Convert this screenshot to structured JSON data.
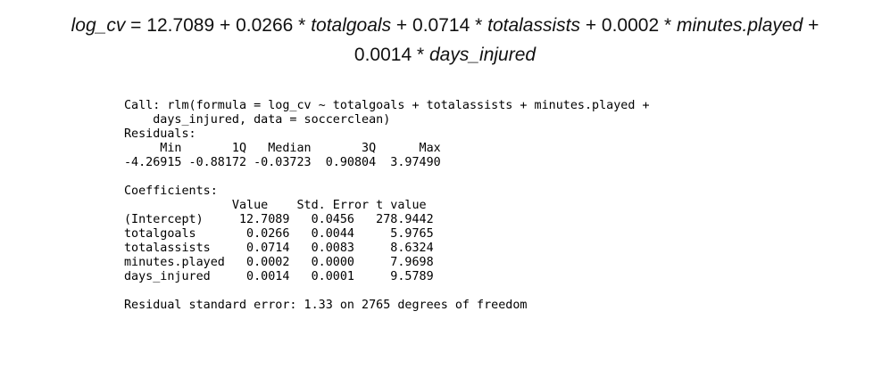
{
  "equation": {
    "lhs": "log_cv",
    "eq": " = 12.7089 + 0.0266 * ",
    "v1": "totalgoals",
    "p1": " + 0.0714 * ",
    "v2": "totalassists",
    "p2": " + 0.0002 * ",
    "v3": "minutes.played",
    "p3": " +",
    "p4": "0.0014 * ",
    "v4": "days_injured"
  },
  "output": {
    "call_line1": "Call: rlm(formula = log_cv ~ totalgoals + totalassists + minutes.played + ",
    "call_line2": "    days_injured, data = soccerclean)",
    "residuals_title": "Residuals:",
    "residuals_header": "     Min       1Q   Median       3Q      Max ",
    "residuals_values": "-4.26915 -0.88172 -0.03723  0.90804  3.97490 ",
    "coef_title": "Coefficients:",
    "coef_header": "               Value    Std. Error t value ",
    "coef_rows": [
      "(Intercept)     12.7089   0.0456   278.9442",
      "totalgoals       0.0266   0.0044     5.9765",
      "totalassists     0.0714   0.0083     8.6324",
      "minutes.played   0.0002   0.0000     7.9698",
      "days_injured     0.0014   0.0001     9.5789"
    ],
    "rse": "Residual standard error: 1.33 on 2765 degrees of freedom"
  }
}
